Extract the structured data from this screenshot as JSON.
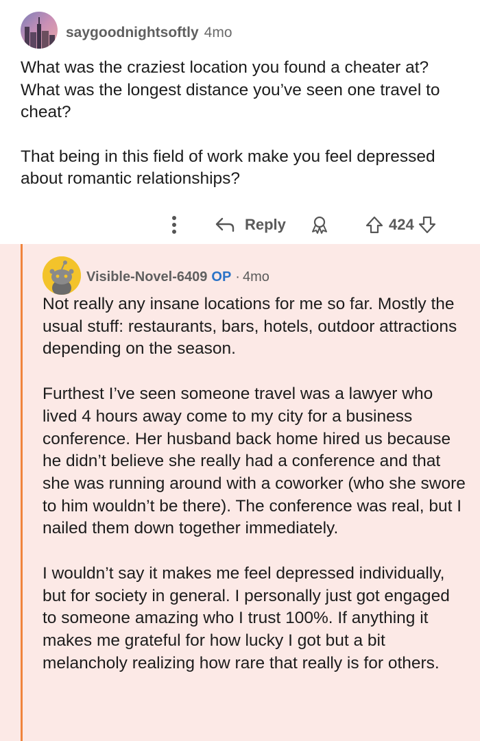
{
  "parent_comment": {
    "username": "saygoodnightsoftly",
    "age": "4mo",
    "paragraphs": [
      "What was the craziest location you found a cheater at? What was the longest distance you’ve seen one travel to cheat?",
      "That being in this field of work make you feel depressed about romantic relationships?"
    ],
    "actions": {
      "reply_label": "Reply",
      "score": "424",
      "more_icon": "more-vertical-icon",
      "reply_icon": "reply-arrow-icon",
      "award_icon": "award-icon",
      "upvote_icon": "upvote-arrow-icon",
      "downvote_icon": "downvote-arrow-icon"
    }
  },
  "reply_comment": {
    "username": "Visible-Novel-6409",
    "op_badge": "OP",
    "separator": "·",
    "age": "4mo",
    "paragraphs": [
      "Not really any insane locations for me so far. Mostly the usual stuff: restaurants, bars, hotels, outdoor attractions depending on the season.",
      "Furthest I’ve seen someone travel was a lawyer who lived 4 hours away come to my city for a business conference. Her husband back home hired us because he didn’t believe she really had a conference and that she was running around with a coworker (who she swore to him wouldn’t be there). The conference was real, but I nailed them down together immediately.",
      "I wouldn’t say it makes me feel depressed individually, but for society in general. I personally just got engaged to someone amazing who I trust 100%. If anything it makes me grateful for how lucky I got but a bit melancholy realizing how rare that really is for others."
    ]
  },
  "colors": {
    "reply_background": "#fce9e6",
    "thread_line": "#f0843c",
    "op_badge": "#2a73c7"
  }
}
